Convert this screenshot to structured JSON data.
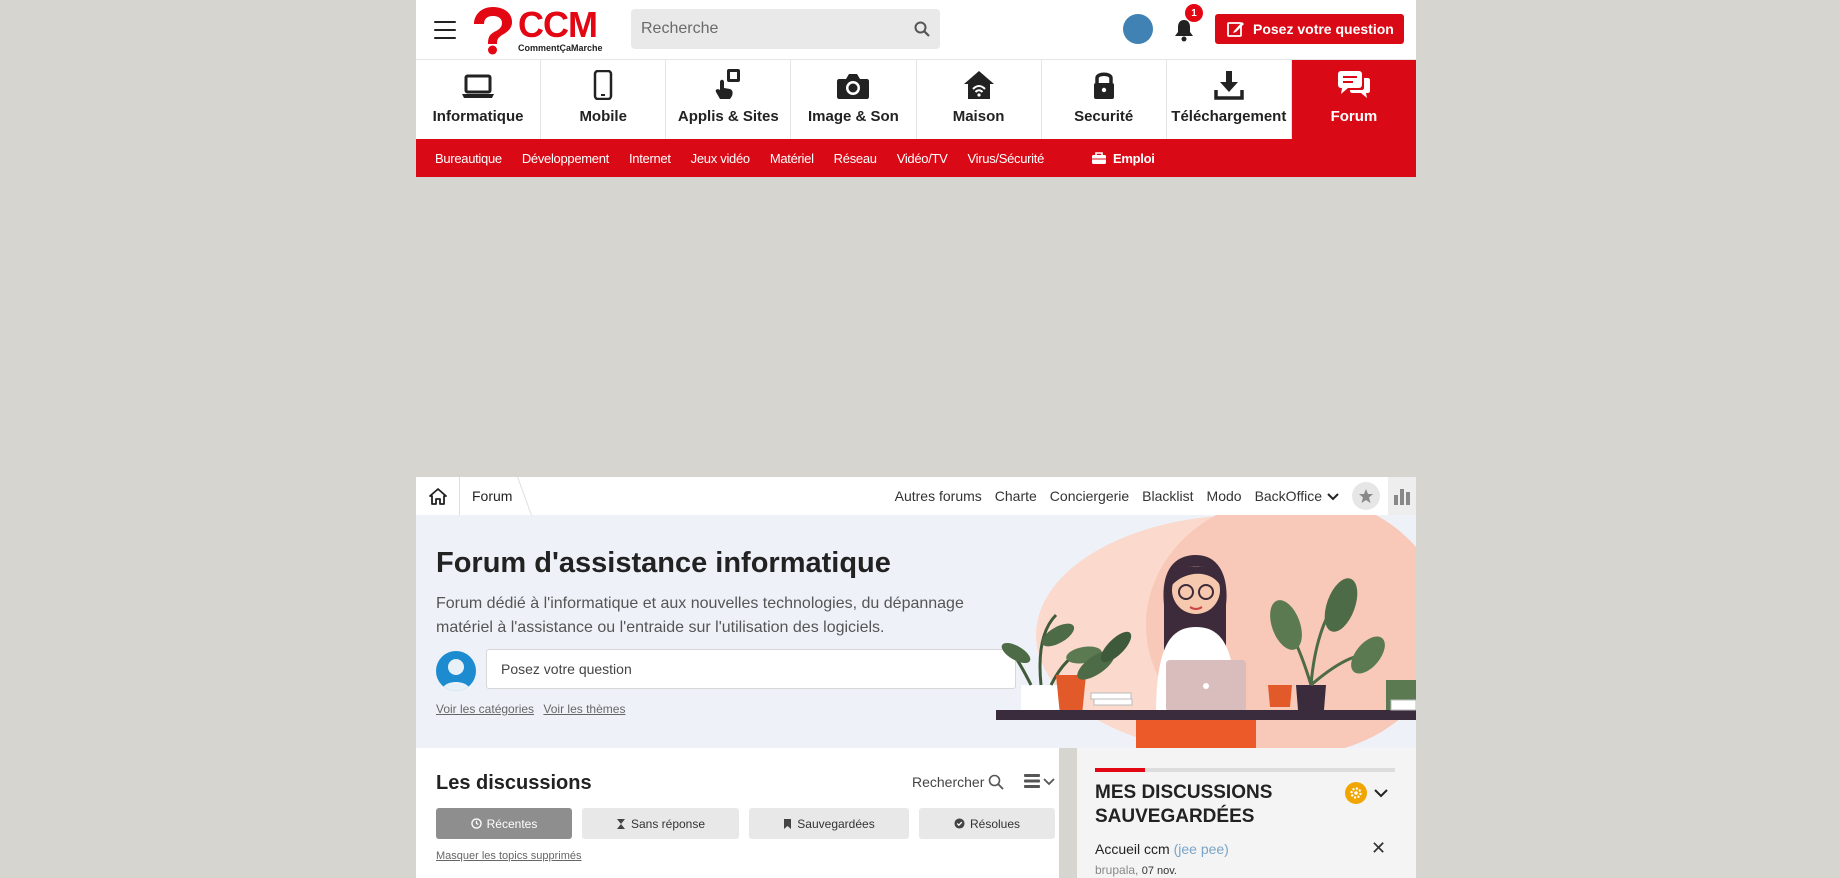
{
  "header": {
    "logo_text": "CCM",
    "logo_subtext": "CommentÇaMarche",
    "search_placeholder": "Recherche",
    "notification_count": "1",
    "ask_button": "Posez votre question"
  },
  "nav": {
    "items": [
      {
        "label": "Informatique",
        "icon": "laptop-icon"
      },
      {
        "label": "Mobile",
        "icon": "phone-icon"
      },
      {
        "label": "Applis & Sites",
        "icon": "apps-icon"
      },
      {
        "label": "Image & Son",
        "icon": "camera-icon"
      },
      {
        "label": "Maison",
        "icon": "house-wifi-icon"
      },
      {
        "label": "Securité",
        "icon": "lock-icon"
      },
      {
        "label": "Téléchargement",
        "icon": "download-icon"
      },
      {
        "label": "Forum",
        "icon": "chat-icon"
      }
    ],
    "active": "Forum"
  },
  "subnav": {
    "items": [
      "Bureautique",
      "Développement",
      "Internet",
      "Jeux vidéo",
      "Matériel",
      "Réseau",
      "Vidéo/TV",
      "Virus/Sécurité"
    ],
    "emploi": "Emploi"
  },
  "breadcrumb": {
    "current": "Forum",
    "links": [
      "Autres forums",
      "Charte",
      "Conciergerie",
      "Blacklist",
      "Modo"
    ],
    "backoffice": "BackOffice"
  },
  "hero": {
    "title": "Forum d'assistance informatique",
    "description": "Forum dédié à l'informatique et aux nouvelles technologies, du dépannage matériel à l'assistance ou l'entraide sur l'utilisation des logiciels.",
    "input_placeholder": "Posez votre question",
    "link_categories": "Voir les catégories",
    "link_themes": "Voir les thèmes"
  },
  "discussions": {
    "title": "Les discussions",
    "search_label": "Rechercher",
    "tabs": [
      "Récentes",
      "Sans réponse",
      "Sauvegardées",
      "Résolues"
    ],
    "active_tab": "Récentes",
    "hide_deleted": "Masquer les topics supprimés"
  },
  "saved": {
    "title": "MES DISCUSSIONS SAUVEGARDÉES",
    "item_title": "Accueil ccm",
    "item_author": "(jee pee)",
    "item_user": "brupala,",
    "item_date": "07 nov."
  },
  "colors": {
    "brand_red": "#d90a16",
    "page_bg": "#d6d5d0",
    "hero_bg": "#eef2f8"
  }
}
